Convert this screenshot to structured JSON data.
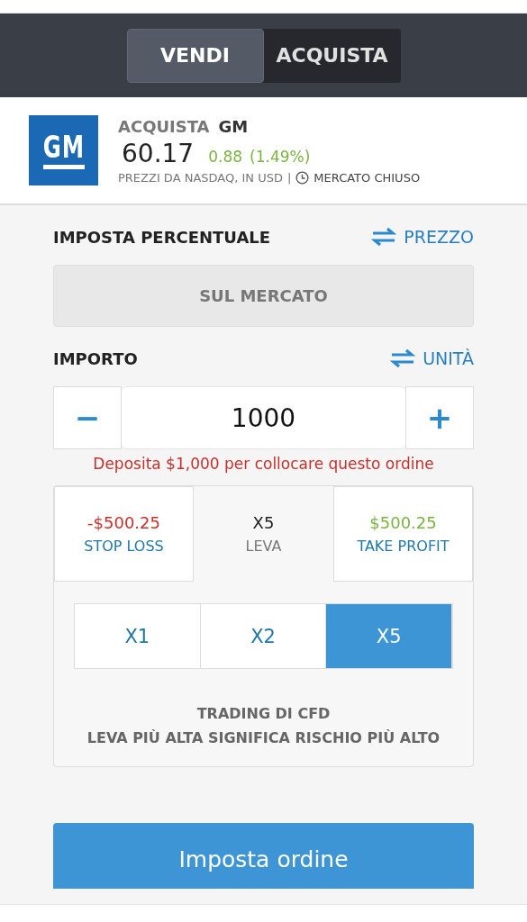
{
  "side_toggle": [
    {
      "label": "VENDI",
      "selected": true
    },
    {
      "label": "ACQUISTA",
      "selected": false
    }
  ],
  "instrument": {
    "action": "ACQUISTA",
    "symbol": "GM",
    "logo_text": "GM",
    "price": "60.17",
    "change": "0.88",
    "change_pct": "(1.49%)",
    "source": "PREZZI DA NASDAQ, IN USD",
    "separator": "|",
    "market_status": "MERCATO CHIUSO"
  },
  "rate_section": {
    "title": "IMPOSTA PERCENTUALE",
    "switch_label": "PREZZO",
    "rate_button": "SUL MERCATO"
  },
  "amount_section": {
    "title": "IMPORTO",
    "switch_label": "UNITÀ",
    "value": "1000",
    "minus": "−",
    "plus": "+",
    "error": "Deposita $1,000 per collocare questo ordine"
  },
  "risk_tabs": [
    {
      "kind": "loss",
      "value": "-$500.25",
      "label": "STOP LOSS",
      "selected": false
    },
    {
      "kind": "leverage",
      "value": "X5",
      "label": "LEVA",
      "selected": true
    },
    {
      "kind": "profit",
      "value": "$500.25",
      "label": "TAKE PROFIT",
      "selected": false
    }
  ],
  "leverage_options": [
    {
      "label": "X1",
      "selected": false
    },
    {
      "label": "X2",
      "selected": false
    },
    {
      "label": "X5",
      "selected": true
    }
  ],
  "warning": {
    "title": "TRADING DI CFD",
    "text": "LEVA PIÙ ALTA SIGNIFICA RISCHIO PIÙ ALTO"
  },
  "submit_button": "Imposta ordine"
}
